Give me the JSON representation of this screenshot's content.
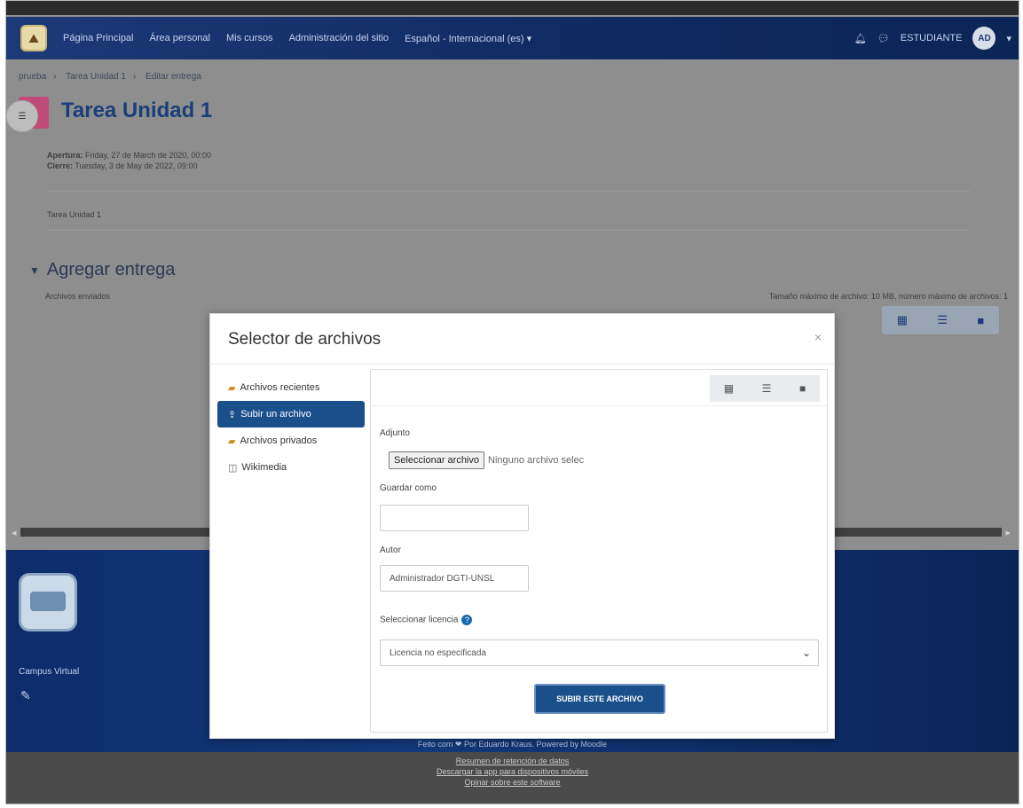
{
  "navbar": {
    "links": [
      "Página Principal",
      "Área personal",
      "Mis cursos",
      "Administración del sitio",
      "Español - Internacional (es) ▾"
    ],
    "user_label": "ESTUDIANTE",
    "avatar_initials": "AD"
  },
  "breadcrumb": [
    "prueba",
    "Tarea Unidad 1",
    "Editar entrega"
  ],
  "assignment": {
    "title": "Tarea Unidad 1",
    "opening_label": "Apertura:",
    "opening_value": "Friday, 27 de March de 2020, 00:00",
    "closing_label": "Cierre:",
    "closing_value": "Tuesday, 3 de May de 2022, 09:00",
    "description": "Tarea Unidad 1"
  },
  "submission": {
    "heading": "Agregar entrega",
    "files_label": "Archivos enviados",
    "max_size_text": "Tamaño máximo de archivo: 10 MB, número máximo de archivos: 1"
  },
  "file_picker": {
    "title": "Selector de archivos",
    "close": "×",
    "repositories": [
      {
        "label": "Archivos recientes",
        "icon": "folder-icon"
      },
      {
        "label": "Subir un archivo",
        "icon": "upload-icon"
      },
      {
        "label": "Archivos privados",
        "icon": "folder-icon"
      },
      {
        "label": "Wikimedia",
        "icon": "wikimedia-icon"
      }
    ],
    "active_repository": "Subir un archivo",
    "attachment_label": "Adjunto",
    "choose_file_button": "Seleccionar archivo",
    "no_file_text": "Ninguno archivo selec",
    "save_as_label": "Guardar como",
    "save_as_value": "",
    "author_label": "Autor",
    "author_value": "Administrador DGTI-UNSL",
    "license_label": "Seleccionar licencia",
    "license_value": "Licencia no especificada",
    "upload_button": "SUBIR ESTE ARCHIVO"
  },
  "footer": {
    "site_name": "Campus Virtual",
    "credit": "Feito com ❤ Por Eduardo Kraus. Powered by Moodle",
    "links": [
      "Resumen de retención de datos",
      "Descargar la app para dispositivos móviles",
      "Opinar sobre este software"
    ]
  }
}
